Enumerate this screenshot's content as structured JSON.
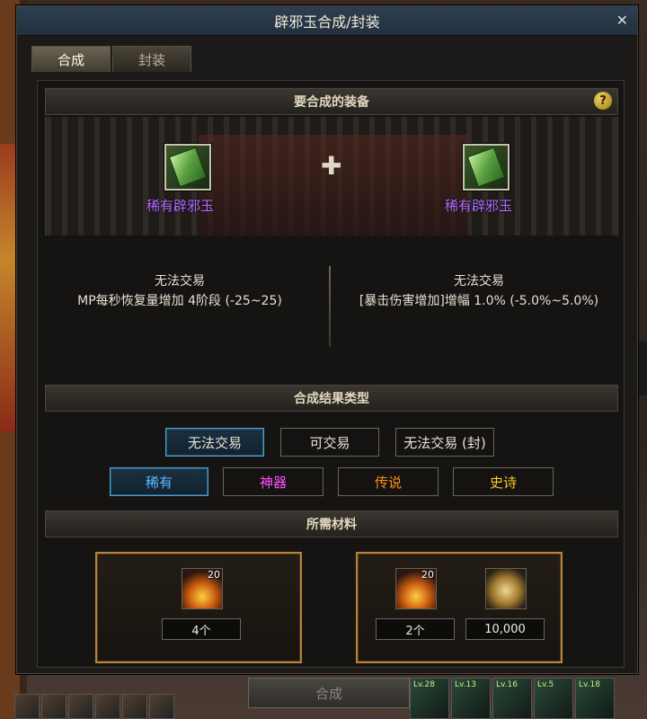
{
  "window": {
    "title": "辟邪玉合成/封装"
  },
  "tabs": [
    {
      "label": "合成"
    },
    {
      "label": "封装"
    }
  ],
  "sections": {
    "equipment": "要合成的装备",
    "result_type": "合成结果类型",
    "materials": "所需材料"
  },
  "equipment": {
    "left": {
      "name": "稀有辟邪玉",
      "trade": "无法交易",
      "stat": "MP每秒恢复量增加 4阶段 (-25~25)"
    },
    "right": {
      "name": "稀有辟邪玉",
      "trade": "无法交易",
      "stat": "[暴击伤害增加]增幅 1.0% (-5.0%~5.0%)"
    }
  },
  "trade_options": [
    {
      "label": "无法交易",
      "selected": true
    },
    {
      "label": "可交易",
      "selected": false
    },
    {
      "label": "无法交易 (封)",
      "selected": false
    }
  ],
  "rarity_options": [
    {
      "label": "稀有",
      "color": "#5fb8ff",
      "selected": true
    },
    {
      "label": "神器",
      "color": "#ff50ff",
      "selected": false
    },
    {
      "label": "传说",
      "color": "#ff8c1a",
      "selected": false
    },
    {
      "label": "史诗",
      "color": "#ffc81a",
      "selected": false
    }
  ],
  "materials": {
    "box1": {
      "badge": "20",
      "qty": "4个"
    },
    "box2": {
      "badge": "20",
      "qty": "2个",
      "gold": "10,000"
    }
  },
  "compose_button": "合成",
  "hotbar_levels": [
    "Lv.28",
    "Lv.13",
    "Lv.16",
    "Lv.5",
    "Lv.18"
  ],
  "colors": {
    "accent_blue": "#4f9fd0",
    "material_border": "#b88238"
  }
}
